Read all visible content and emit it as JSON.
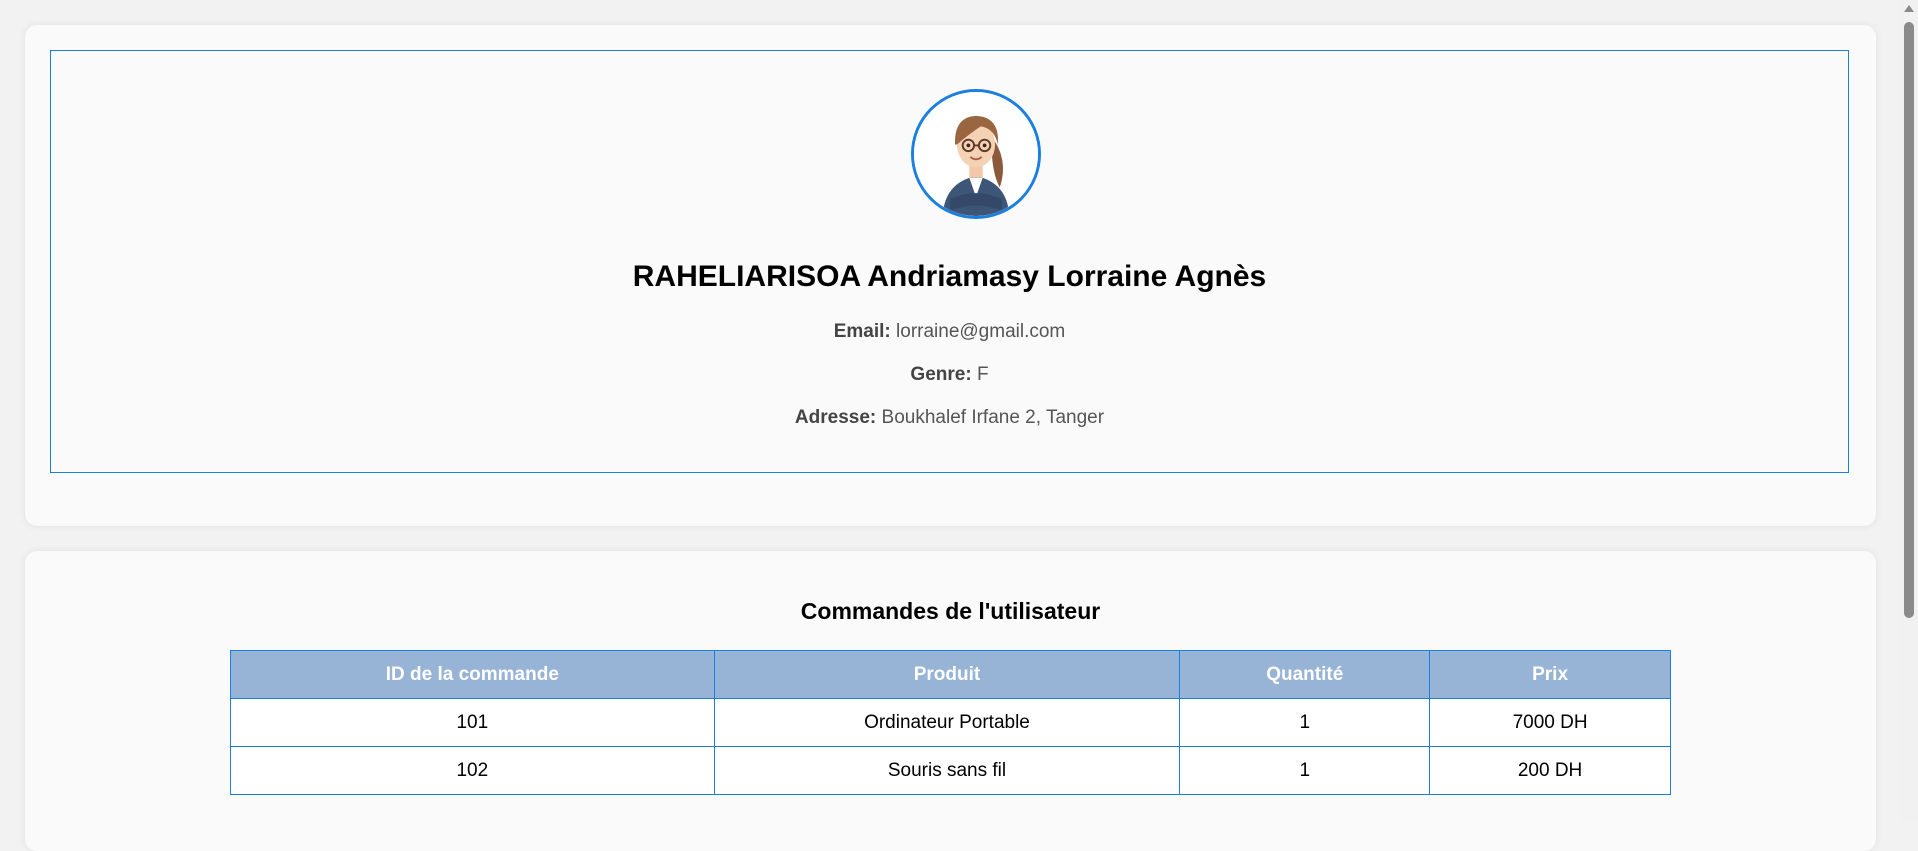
{
  "profile": {
    "avatar_icon": "user-avatar-icon",
    "name": "RAHELIARISOA Andriamasy Lorraine Agnès",
    "email_label": "Email:",
    "email": "lorraine@gmail.com",
    "genre_label": "Genre:",
    "genre": "F",
    "adresse_label": "Adresse:",
    "adresse": "Boukhalef Irfane 2, Tanger"
  },
  "orders": {
    "title": "Commandes de l'utilisateur",
    "columns": [
      "ID de la commande",
      "Produit",
      "Quantité",
      "Prix"
    ],
    "rows": [
      [
        "101",
        "Ordinateur Portable",
        "1",
        "7000 DH"
      ],
      [
        "102",
        "Souris sans fil",
        "1",
        "200 DH"
      ]
    ]
  },
  "colors": {
    "accent": "#1a7fe0",
    "table_header": "#97b3d5",
    "card_background": "#fafafa",
    "page_background": "#f2f2f2"
  }
}
